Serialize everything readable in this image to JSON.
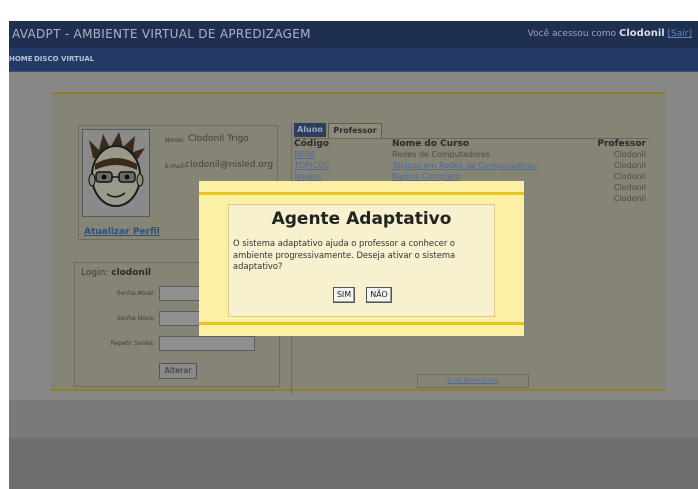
{
  "app": {
    "title": "AVADPT - AMBIENTE VIRTUAL DE APREDIZAGEM",
    "user_prefix": "Você acessou como",
    "user_name": "Clodonil",
    "exit_label": "[Sair]"
  },
  "nav": {
    "items": [
      {
        "label": "HOME"
      },
      {
        "label": "DISCO VIRTUAL"
      }
    ]
  },
  "profile": {
    "name_label": "Nome:",
    "name_value": "Clodonil Trigo",
    "email_label": "E-mail:",
    "email_value": "clodonil@nisled.org",
    "update_link": "Atualizar Perfil"
  },
  "login": {
    "login_label": "Login:",
    "login_value": "clodonil",
    "fields": [
      {
        "label": "Senha Atual:"
      },
      {
        "label": "Senha Nova:"
      },
      {
        "label": "Repetir Senha:"
      }
    ],
    "submit_label": "Alterar"
  },
  "tabs": [
    {
      "label": "Aluno"
    },
    {
      "label": "Professor"
    }
  ],
  "courses": {
    "headers": [
      "Código",
      "Nome do Curso",
      "Professor"
    ],
    "rows": [
      {
        "code": "REDE",
        "name": "Redes de Computadores",
        "professor": "Clodonil",
        "linked": false
      },
      {
        "code": "TOPICOS",
        "name": "Topicos em Redes de Computadores",
        "professor": "Clodonil",
        "linked": true
      },
      {
        "code": "Nagios",
        "name": "Nagios Completo",
        "professor": "Clodonil",
        "linked": true
      },
      {
        "code": "",
        "name": "",
        "professor": "Clodonil",
        "linked": false
      },
      {
        "code": "",
        "name": "",
        "professor": "Clodonil",
        "linked": false
      }
    ],
    "new_course_label": "Criar Novo Curso"
  },
  "dialog": {
    "title": "Agente Adaptativo",
    "message": "O sistema adaptativo ajuda o professor a conhecer o ambiente progressivamente. Deseja ativar o sistema adaptativo?",
    "yes_label": "SIM",
    "no_label": "NÃO"
  }
}
